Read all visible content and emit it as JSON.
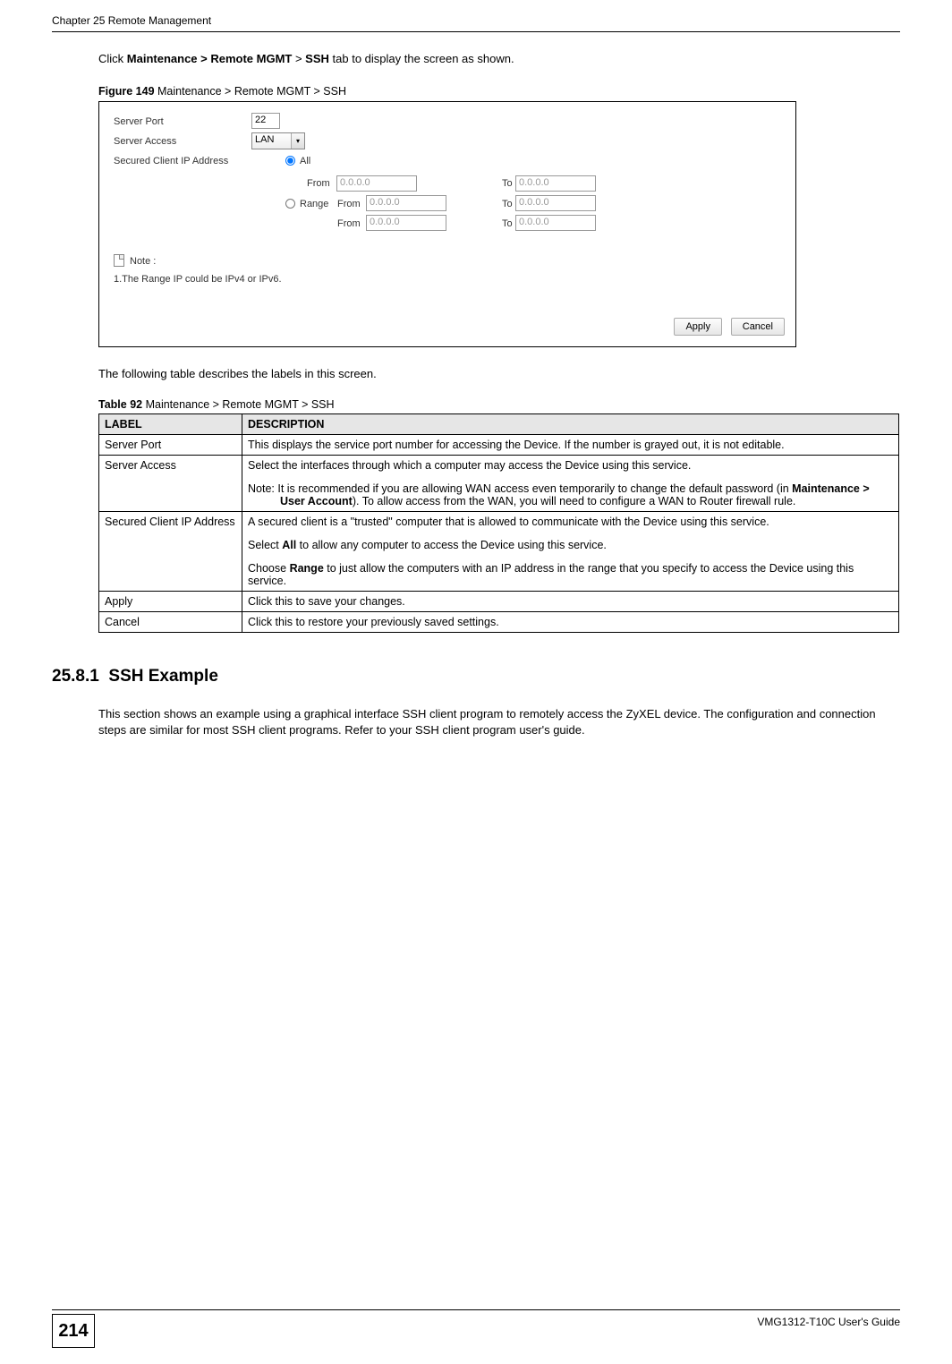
{
  "header": {
    "chapter": "Chapter 25 Remote Management"
  },
  "intro": {
    "pre": "Click ",
    "bold1": "Maintenance > Remote MGMT",
    "mid": " > ",
    "bold2": "SSH",
    "post": " tab to display the screen as shown."
  },
  "figure": {
    "label": "Figure 149",
    "title": "   Maintenance > Remote MGMT > SSH"
  },
  "screenshot": {
    "labels": {
      "server_port": "Server Port",
      "server_access": "Server Access",
      "secured_client": "Secured Client IP Address",
      "all": "All",
      "range": "Range",
      "from": "From",
      "to": "To",
      "note": "Note :",
      "note_line1": "1.The Range IP could be IPv4 or IPv6."
    },
    "values": {
      "server_port": "22",
      "server_access": "LAN",
      "ip_placeholder": "0.0.0.0"
    },
    "buttons": {
      "apply": "Apply",
      "cancel": "Cancel"
    }
  },
  "post_figure": "The following table describes the labels in this screen.",
  "table": {
    "label": "Table 92",
    "title": "   Maintenance > Remote MGMT > SSH",
    "headers": {
      "label": "LABEL",
      "description": "DESCRIPTION"
    },
    "rows": [
      {
        "label": "Server Port",
        "desc": "This displays the service port number for accessing the Device. If the number is grayed out, it is not editable."
      },
      {
        "label": "Server Access",
        "desc_main": "Select the interfaces through which a computer may access the Device using this service.",
        "note_prefix": "Note: It is recommended if you are allowing WAN access even temporarily to change the default password (in ",
        "note_bold": "Maintenance > User Account",
        "note_suffix": "). To allow access from the WAN, you will need to configure a WAN to Router firewall rule."
      },
      {
        "label": "Secured Client IP Address",
        "p1": "A secured client is a \"trusted\" computer that is allowed to communicate with the Device using this service.",
        "p2_pre": "Select ",
        "p2_bold": "All",
        "p2_post": " to allow any computer to access the Device using this service.",
        "p3_pre": "Choose ",
        "p3_bold": "Range",
        "p3_post": " to just allow the computers with an IP address in the range that you specify to access the Device using this service."
      },
      {
        "label": "Apply",
        "desc": "Click this to save your changes."
      },
      {
        "label": "Cancel",
        "desc": "Click this to restore your previously saved settings."
      }
    ]
  },
  "section": {
    "number": "25.8.1",
    "title": "SSH Example",
    "text": "This section shows an example using a graphical interface SSH client program to remotely access the ZyXEL device. The configuration and connection steps are similar for most SSH client programs. Refer to your SSH client program user's guide."
  },
  "footer": {
    "page": "214",
    "guide": "VMG1312-T10C User's Guide"
  }
}
